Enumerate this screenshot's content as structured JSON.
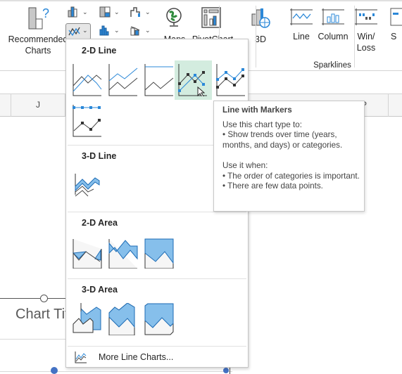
{
  "ribbon": {
    "recommended_charts": [
      "Recommended",
      "Charts"
    ],
    "maps": "Maps",
    "pivotchart": "PivotChart",
    "three_d": "3D",
    "sparklines": {
      "group_label": "Sparklines",
      "line": "Line",
      "column": "Column",
      "winloss": [
        "Win/",
        "Loss"
      ]
    },
    "cut_label": "S"
  },
  "sheet": {
    "column_j": "J",
    "column_p": "P",
    "chart_title": "Chart Tit"
  },
  "menu": {
    "sections": [
      {
        "title": "2-D Line",
        "items": [
          "Line",
          "Stacked Line",
          "100% Stacked Line",
          "Line with Markers",
          "Stacked Line with Markers",
          "100% Stacked Line with Markers"
        ]
      },
      {
        "title": "3-D Line",
        "items": [
          "3-D Line"
        ]
      },
      {
        "title": "2-D Area",
        "items": [
          "Area",
          "Stacked Area",
          "100% Stacked Area"
        ]
      },
      {
        "title": "3-D Area",
        "items": [
          "3-D Area",
          "3-D Stacked Area",
          "3-D 100% Stacked Area"
        ]
      }
    ],
    "highlighted": "Line with Markers",
    "more": "More Line Charts..."
  },
  "tooltip": {
    "title": "Line with Markers",
    "lines": [
      "Use this chart type to:",
      "• Show trends over time (years, months, and days) or categories.",
      "",
      "Use it when:",
      "• The order of categories is important.",
      "• There are few data points."
    ]
  },
  "colors": {
    "accent": "#2b88d8",
    "hover": "#d3ecdf",
    "area": "#86bfeb"
  }
}
